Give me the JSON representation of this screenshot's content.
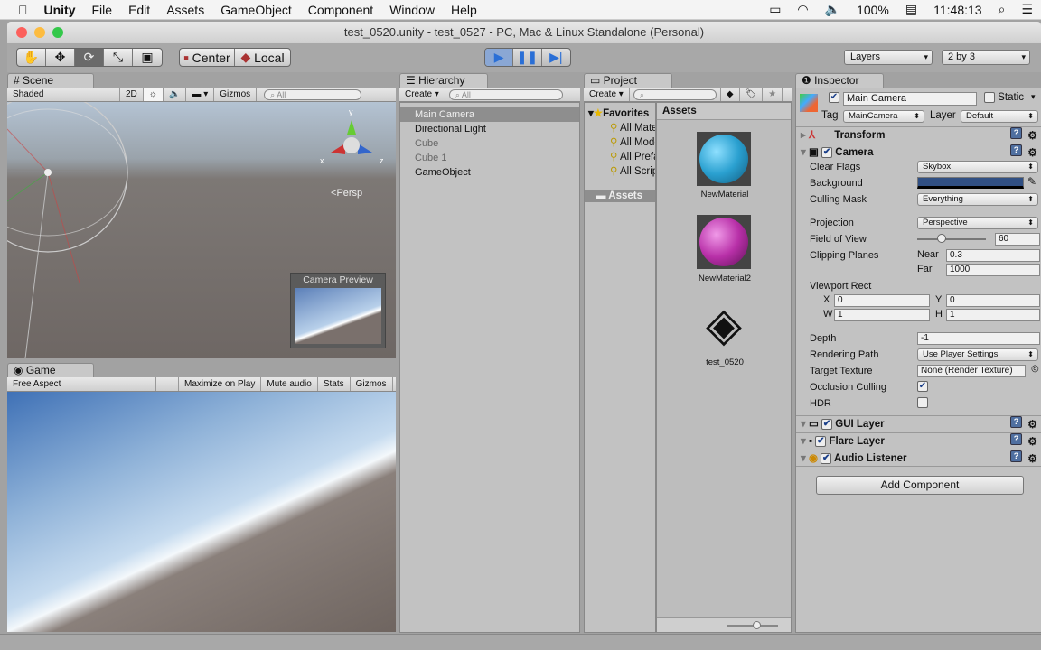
{
  "menubar": {
    "app": "Unity",
    "items": [
      "File",
      "Edit",
      "Assets",
      "GameObject",
      "Component",
      "Window",
      "Help"
    ],
    "battery": "100%",
    "time": "11:48:13"
  },
  "window": {
    "title": "test_0520.unity - test_0527 - PC, Mac & Linux Standalone (Personal)"
  },
  "toolbar": {
    "pivot": "Center",
    "space": "Local",
    "layers": "Layers",
    "layout": "2 by 3"
  },
  "scene": {
    "tab": "Scene",
    "shading": "Shaded",
    "mode2d": "2D",
    "gizmos": "Gizmos",
    "search_placeholder": "All",
    "persp": "Persp",
    "camera_preview": "Camera Preview",
    "axis_x": "x",
    "axis_y": "y",
    "axis_z": "z"
  },
  "game": {
    "tab": "Game",
    "aspect": "Free Aspect",
    "maximize": "Maximize on Play",
    "mute": "Mute audio",
    "stats": "Stats",
    "gizmos": "Gizmos"
  },
  "hierarchy": {
    "tab": "Hierarchy",
    "create": "Create",
    "search_placeholder": "All",
    "items": [
      "Main Camera",
      "Directional Light",
      "Cube",
      "Cube 1",
      "GameObject"
    ]
  },
  "project": {
    "tab": "Project",
    "create": "Create",
    "favorites": "Favorites",
    "fav_items": [
      "All Materials",
      "All Models",
      "All Prefabs",
      "All Scripts"
    ],
    "assets_folder": "Assets",
    "assets_header": "Assets",
    "assets": [
      "NewMaterial",
      "NewMaterial2",
      "test_0520"
    ]
  },
  "inspector": {
    "tab": "Inspector",
    "name": "Main Camera",
    "static": "Static",
    "tag_label": "Tag",
    "tag": "MainCamera",
    "layer_label": "Layer",
    "layer": "Default",
    "transform": "Transform",
    "camera": "Camera",
    "clear_flags_label": "Clear Flags",
    "clear_flags": "Skybox",
    "background_label": "Background",
    "background_color": "#304f83",
    "culling_mask_label": "Culling Mask",
    "culling_mask": "Everything",
    "projection_label": "Projection",
    "projection": "Perspective",
    "fov_label": "Field of View",
    "fov": "60",
    "clipping_label": "Clipping Planes",
    "near_label": "Near",
    "near": "0.3",
    "far_label": "Far",
    "far": "1000",
    "viewport_label": "Viewport Rect",
    "x_label": "X",
    "x": "0",
    "y_label": "Y",
    "y": "0",
    "w_label": "W",
    "w": "1",
    "h_label": "H",
    "h": "1",
    "depth_label": "Depth",
    "depth": "-1",
    "rendering_path_label": "Rendering Path",
    "rendering_path": "Use Player Settings",
    "target_texture_label": "Target Texture",
    "target_texture": "None (Render Texture)",
    "occlusion_label": "Occlusion Culling",
    "hdr_label": "HDR",
    "gui_layer": "GUI Layer",
    "flare_layer": "Flare Layer",
    "audio_listener": "Audio Listener",
    "add_component": "Add Component"
  }
}
